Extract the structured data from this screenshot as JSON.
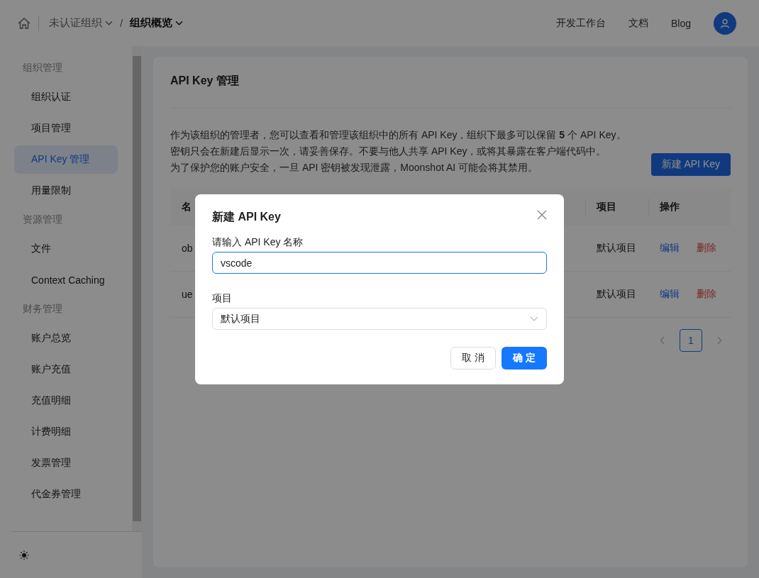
{
  "header": {
    "breadcrumb": [
      {
        "label": "未认证组织",
        "selected": false
      },
      {
        "label": "组织概览",
        "selected": true
      }
    ],
    "separator": "/",
    "links": [
      "开发工作台",
      "文档",
      "Blog"
    ]
  },
  "sidebar": {
    "groups": [
      {
        "title": "组织管理",
        "items": [
          {
            "label": "组织认证",
            "selected": false
          },
          {
            "label": "项目管理",
            "selected": false
          },
          {
            "label": "API Key 管理",
            "selected": true
          },
          {
            "label": "用量限制",
            "selected": false
          }
        ]
      },
      {
        "title": "资源管理",
        "items": [
          {
            "label": "文件",
            "selected": false
          },
          {
            "label": "Context Caching",
            "selected": false
          }
        ]
      },
      {
        "title": "财务管理",
        "items": [
          {
            "label": "账户总览",
            "selected": false
          },
          {
            "label": "账户充值",
            "selected": false
          },
          {
            "label": "充值明细",
            "selected": false
          },
          {
            "label": "计费明细",
            "selected": false
          },
          {
            "label": "发票管理",
            "selected": false
          },
          {
            "label": "代金券管理",
            "selected": false
          }
        ]
      }
    ]
  },
  "card": {
    "title": "API Key 管理",
    "description": [
      "作为该组织的管理者，您可以查看和管理该组织中的所有 API Key，组织下最多可以保留 **5** 个 API Key。",
      "密钥只会在新建后显示一次，请妥善保存。不要与他人共享 API Key，或将其暴露在客户端代码中。",
      "为了保护您的账户安全，一旦 API 密钥被发现泄露，Moonshot AI 可能会将其禁用。"
    ],
    "create_button": "新建 API Key",
    "table": {
      "columns": [
        "名",
        "项目",
        "操作"
      ],
      "rows": [
        {
          "name": "ob",
          "project": "默认项目",
          "actions": [
            {
              "label": "编辑",
              "kind": "edit"
            },
            {
              "label": "删除",
              "kind": "delete"
            }
          ]
        },
        {
          "name": "ue",
          "project": "默认项目",
          "actions": [
            {
              "label": "编辑",
              "kind": "edit"
            },
            {
              "label": "删除",
              "kind": "delete"
            }
          ]
        }
      ]
    },
    "pagination": {
      "pages": [
        {
          "label": "1",
          "selected": true
        }
      ]
    }
  },
  "modal": {
    "title": "新建 API Key",
    "fields": [
      {
        "kind": "input",
        "label": "请输入 API Key 名称",
        "value": "vscode"
      },
      {
        "kind": "select",
        "label": "项目",
        "value": "默认项目"
      }
    ],
    "buttons": [
      {
        "label": "取 消",
        "kind": "default"
      },
      {
        "label": "确 定",
        "kind": "primary"
      }
    ]
  }
}
